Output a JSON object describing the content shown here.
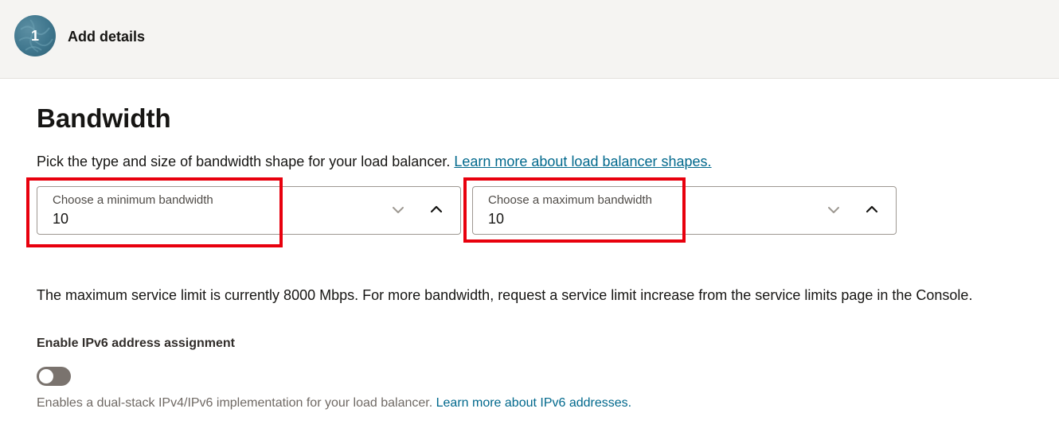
{
  "wizard": {
    "step_number": "1",
    "step_title": "Add details"
  },
  "bandwidth": {
    "title": "Bandwidth",
    "description": "Pick the type and size of bandwidth shape for your load balancer.",
    "learn_more_link": "Learn more about load balancer shapes.",
    "min_select": {
      "label": "Choose a minimum bandwidth",
      "value": "10"
    },
    "max_select": {
      "label": "Choose a maximum bandwidth",
      "value": "10"
    },
    "limit_text": "The maximum service limit is currently 8000 Mbps. For more bandwidth, request a service limit increase from the service limits page in the Console."
  },
  "ipv6": {
    "label": "Enable IPv6 address assignment",
    "enabled": false,
    "helper_text": "Enables a dual-stack IPv4/IPv6 implementation for your load balancer.",
    "learn_more_link": "Learn more about IPv6 addresses."
  },
  "icons": {
    "dropdown": "chevron-down-icon",
    "collapse": "chevron-up-icon"
  },
  "colors": {
    "accent_link": "#00688c",
    "highlight": "#e8000d",
    "step_circle": "#3f768d",
    "toggle_off": "#7a736e"
  }
}
